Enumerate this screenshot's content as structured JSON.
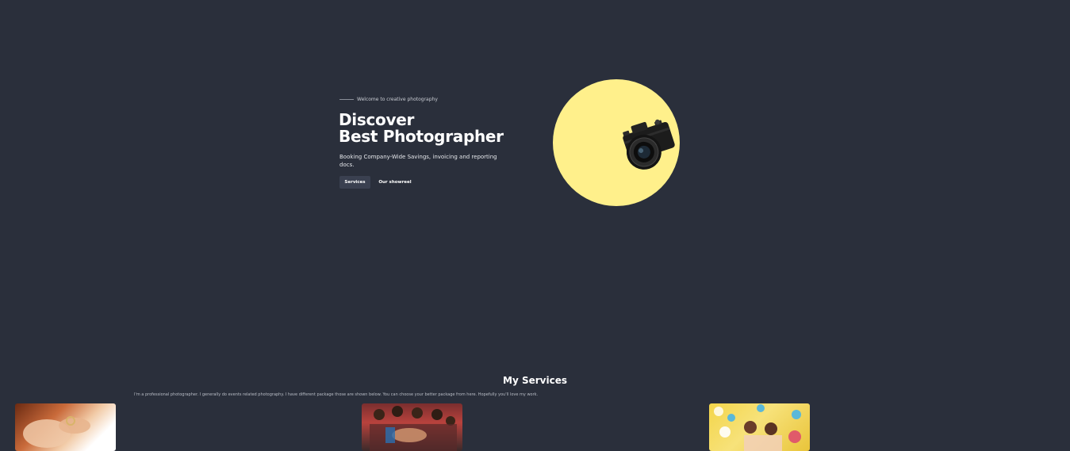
{
  "hero": {
    "tagline": "Welcome to creative photography",
    "title_line1": "Discover",
    "title_line2": "Best Photographer",
    "description": "Booking Company-Wide Savings, invoicing and reporting docs.",
    "primary_button": "Services",
    "secondary_button": "Our showreel",
    "accent_color": "#fff08b",
    "background_color": "#2a2f3b",
    "illustration": "camera-icon"
  },
  "services": {
    "title": "My Services",
    "intro": "I'm a professional photographer. I generally do events related photography. I have different package those are shown below. You can choose your better package from here. Hopefully you'll love my work.",
    "cards": [
      {
        "image": "wedding-rings-photo"
      },
      {
        "image": "group-celebration-photo"
      },
      {
        "image": "kids-party-photo"
      }
    ]
  }
}
